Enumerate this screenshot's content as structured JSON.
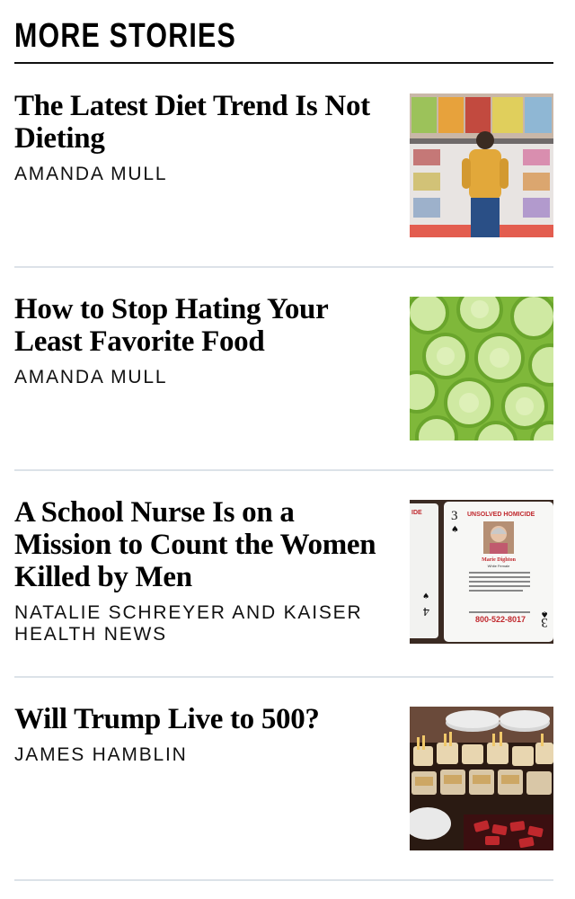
{
  "section": {
    "title": "MORE STORIES"
  },
  "stories": [
    {
      "headline": "The Latest Diet Trend Is Not Dieting",
      "byline": "AMANDA MULL",
      "image_icon": "candy-store-child-photo"
    },
    {
      "headline": "How to Stop Hating Your Least Favorite Food",
      "byline": "AMANDA MULL",
      "image_icon": "cucumber-slices-photo"
    },
    {
      "headline": "A School Nurse Is on a Mission to Count the Women Killed by Men",
      "byline": "NATALIE SCHREYER AND KAISER HEALTH NEWS",
      "image_icon": "unsolved-homicide-playing-card-photo",
      "image_text": {
        "card_rank": "3",
        "card_rank_side": "4",
        "card_title": "UNSOLVED HOMICIDE",
        "card_name": "Marie Dighton",
        "card_subtitle": "White Female",
        "card_phone": "800-522-8017",
        "card_left_edge": "IDE"
      }
    },
    {
      "headline": "Will Trump Live to 500?",
      "byline": "JAMES HAMBLIN",
      "image_icon": "fast-food-buffet-photo"
    }
  ],
  "colors": {
    "title_rule": "#111111",
    "divider": "#dce2e8",
    "card_red": "#c0282d"
  }
}
